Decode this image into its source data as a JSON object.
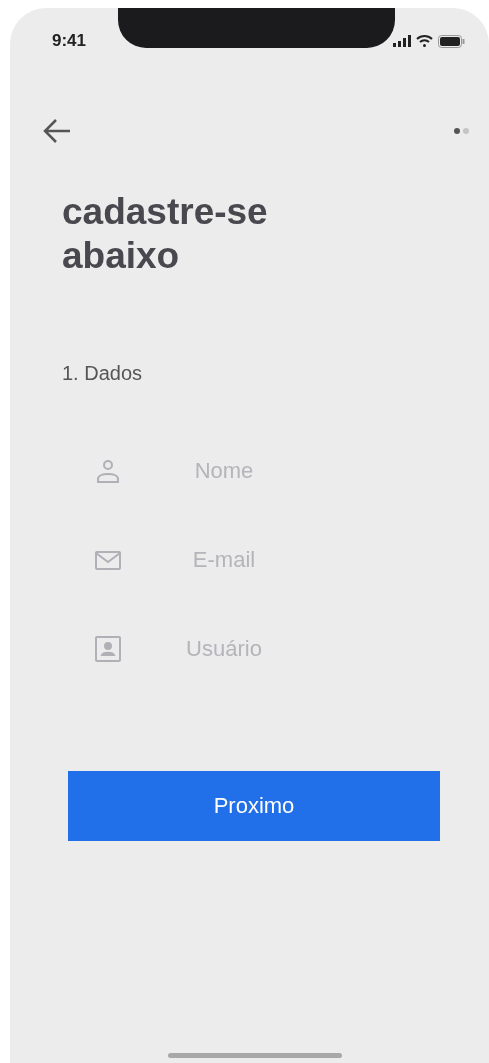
{
  "status_bar": {
    "time": "9:41"
  },
  "page_dots": [
    {
      "selected": true
    },
    {
      "selected": false
    }
  ],
  "title": "cadastre-se abaixo",
  "step": "1. Dados",
  "fields": [
    {
      "kind": "person",
      "placeholder": "Nome"
    },
    {
      "kind": "mail",
      "placeholder": "E-mail"
    },
    {
      "kind": "user",
      "placeholder": "Usuário"
    }
  ],
  "button": "Proximo"
}
